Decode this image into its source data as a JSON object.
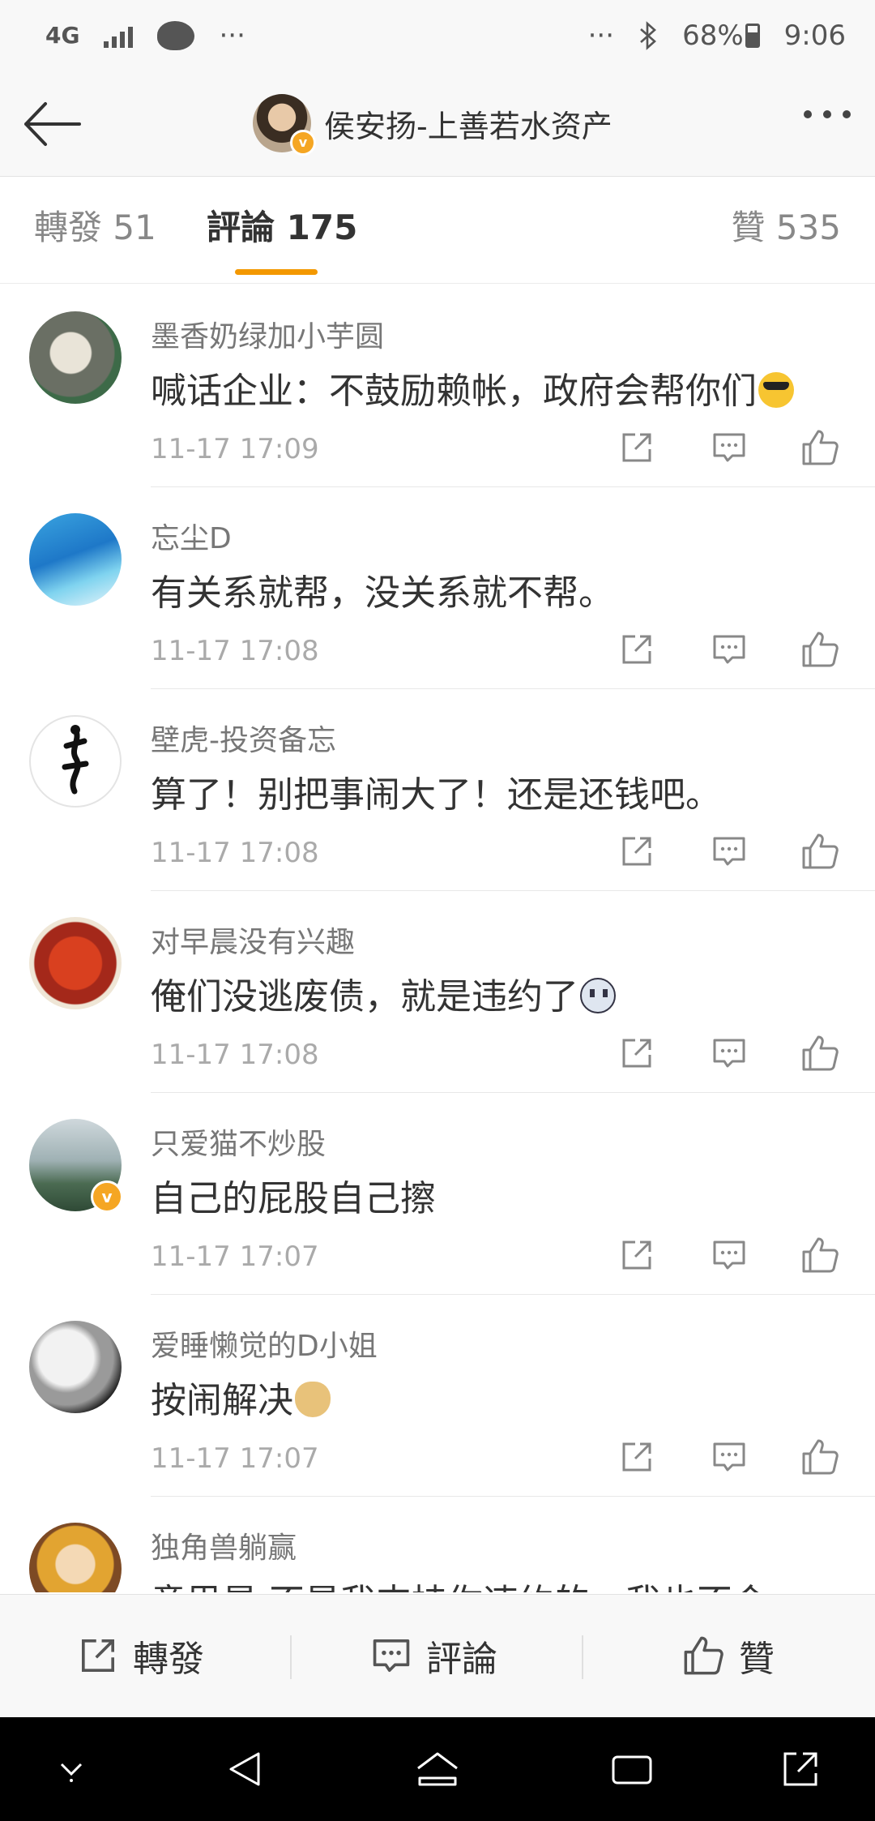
{
  "status_bar": {
    "network": "4G",
    "dots_left": "···",
    "dots_right": "···",
    "battery": "68%",
    "time": "9:06"
  },
  "header": {
    "title": "侯安扬-上善若水资产",
    "verified_badge": "v"
  },
  "tabs": {
    "reposts": "轉發 51",
    "comments": "評論 175",
    "likes": "贊 535",
    "active": "comments",
    "accent_color": "#f39800"
  },
  "comments": [
    {
      "name": "墨香奶绿加小芋圆",
      "text": "喊话企业：不鼓励赖帐，政府会帮你们",
      "emoji": "cool-emoji",
      "time": "11-17 17:09"
    },
    {
      "name": "忘尘D",
      "text": "有关系就帮，没关系就不帮。",
      "emoji": "",
      "time": "11-17 17:08"
    },
    {
      "name": "壁虎-投资备忘",
      "text": "算了！别把事闹大了！还是还钱吧。",
      "emoji": "",
      "time": "11-17 17:08"
    },
    {
      "name": "对早晨没有兴趣",
      "text": "俺们没逃废债，就是违约了",
      "emoji": "ghost-emoji",
      "time": "11-17 17:08"
    },
    {
      "name": "只爱猫不炒股",
      "text": "自己的屁股自己擦",
      "emoji": "",
      "time": "11-17 17:07",
      "verified": "v"
    },
    {
      "name": "爱睡懒觉的D小姐",
      "text": "按闹解决",
      "emoji": "doge-emoji",
      "time": "11-17 17:07"
    },
    {
      "name": "独角兽躺赢",
      "text": "意思是 不是我支持你违约的，我也不会",
      "emoji": "",
      "time": ""
    }
  ],
  "bottom_bar": {
    "repost": "轉發",
    "comment": "評論",
    "like": "贊"
  }
}
